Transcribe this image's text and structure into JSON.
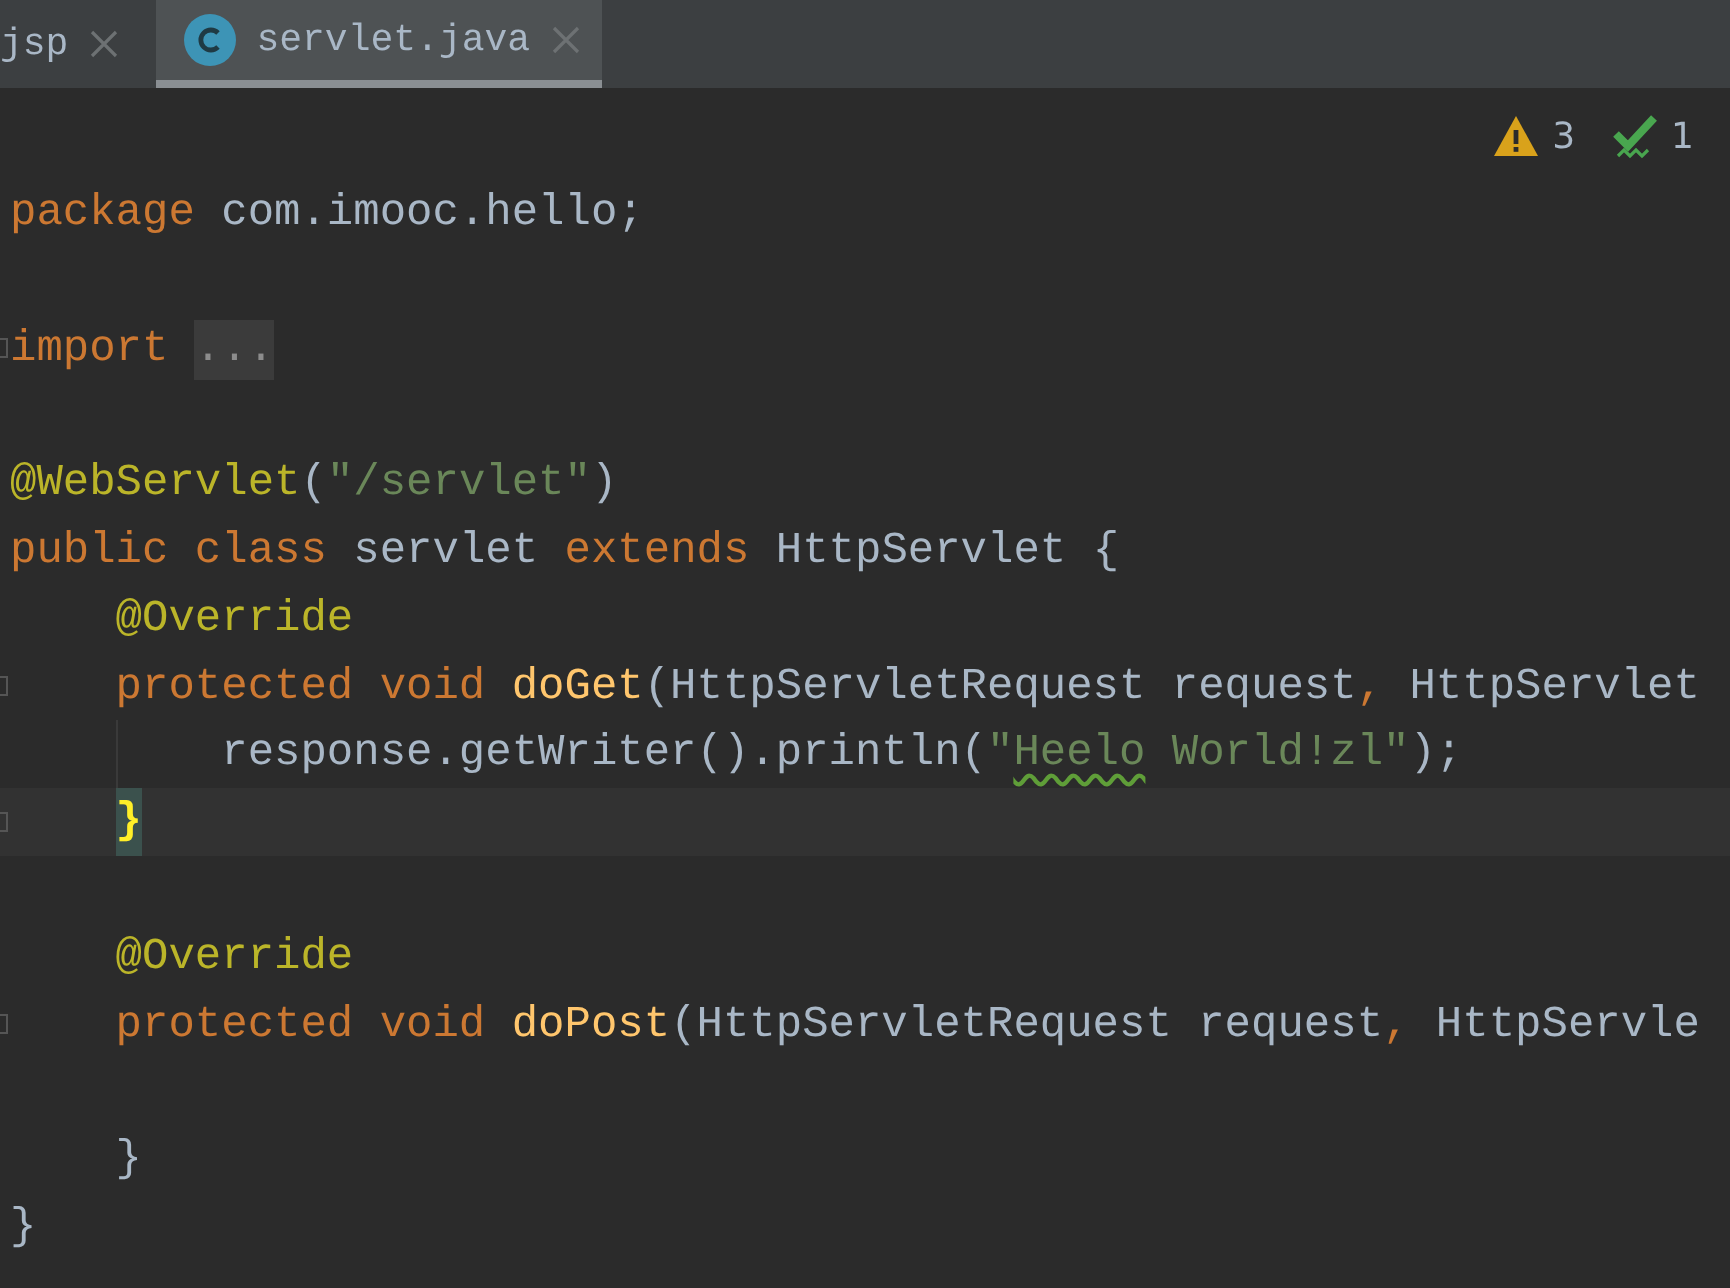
{
  "tabs": [
    {
      "label": "jsp",
      "selected": false,
      "kind": "plain"
    },
    {
      "label": "servlet.java",
      "selected": true,
      "kind": "class"
    }
  ],
  "inspections": {
    "warnings": "3",
    "weak_warnings": "1"
  },
  "lines": [
    {
      "fold": false,
      "indent_guide": false,
      "tokens": [
        {
          "kind": "keyword",
          "text": "package"
        },
        {
          "kind": "plain",
          "text": " com.imooc.hello;"
        }
      ]
    },
    {
      "fold": false,
      "indent_guide": false
    },
    {
      "fold": true,
      "indent_guide": false,
      "tokens": [
        {
          "kind": "keyword",
          "text": "import "
        },
        {
          "kind": "folded",
          "text": "..."
        }
      ]
    },
    {
      "fold": false,
      "indent_guide": false
    },
    {
      "fold": false,
      "indent_guide": false,
      "tokens": [
        {
          "kind": "annotation",
          "text": "@WebServlet"
        },
        {
          "kind": "plain",
          "text": "("
        },
        {
          "kind": "string",
          "text": "\"/servlet\""
        },
        {
          "kind": "plain",
          "text": ")"
        }
      ]
    },
    {
      "fold": false,
      "indent_guide": false,
      "tokens": [
        {
          "kind": "keyword",
          "text": "public class"
        },
        {
          "kind": "plain",
          "text": " servlet "
        },
        {
          "kind": "keyword",
          "text": "extends"
        },
        {
          "kind": "plain",
          "text": " HttpServlet {"
        }
      ]
    },
    {
      "fold": false,
      "indent_guide": false,
      "tokens": [
        {
          "kind": "annotation",
          "text": "    @Override"
        }
      ]
    },
    {
      "fold": true,
      "indent_guide": false,
      "tokens": [
        {
          "kind": "keyword",
          "text": "    protected void "
        },
        {
          "kind": "method",
          "text": "doGet"
        },
        {
          "kind": "plain",
          "text": "(HttpServletRequest request"
        },
        {
          "kind": "keyword",
          "text": ","
        },
        {
          "kind": "plain",
          "text": " HttpServlet"
        }
      ]
    },
    {
      "fold": false,
      "indent_guide": true,
      "tokens": [
        {
          "kind": "plain",
          "text": "        response.getWriter().println("
        },
        {
          "kind": "string",
          "text": "\""
        },
        {
          "kind": "typo",
          "text": "Heelo"
        },
        {
          "kind": "string",
          "text": " World!zl\""
        },
        {
          "kind": "plain",
          "text": ");"
        }
      ]
    },
    {
      "current": true,
      "indented": true,
      "fold": true,
      "indent_guide": false,
      "tokens": [
        {
          "kind": "brace-match",
          "text": "}"
        }
      ]
    },
    {
      "fold": false,
      "indent_guide": false
    },
    {
      "fold": false,
      "indent_guide": false,
      "tokens": [
        {
          "kind": "annotation",
          "text": "    @Override"
        }
      ]
    },
    {
      "fold": true,
      "indent_guide": false,
      "tokens": [
        {
          "kind": "keyword",
          "text": "    protected void "
        },
        {
          "kind": "method",
          "text": "doPost"
        },
        {
          "kind": "plain",
          "text": "(HttpServletRequest request"
        },
        {
          "kind": "keyword",
          "text": ","
        },
        {
          "kind": "plain",
          "text": " HttpServle"
        }
      ]
    },
    {
      "fold": false,
      "indent_guide": false
    },
    {
      "fold": false,
      "indent_guide": false,
      "tokens": [
        {
          "kind": "plain",
          "text": "    }"
        }
      ]
    },
    {
      "fold": false,
      "indent_guide": false,
      "tokens": [
        {
          "kind": "plain",
          "text": "}"
        }
      ]
    }
  ]
}
